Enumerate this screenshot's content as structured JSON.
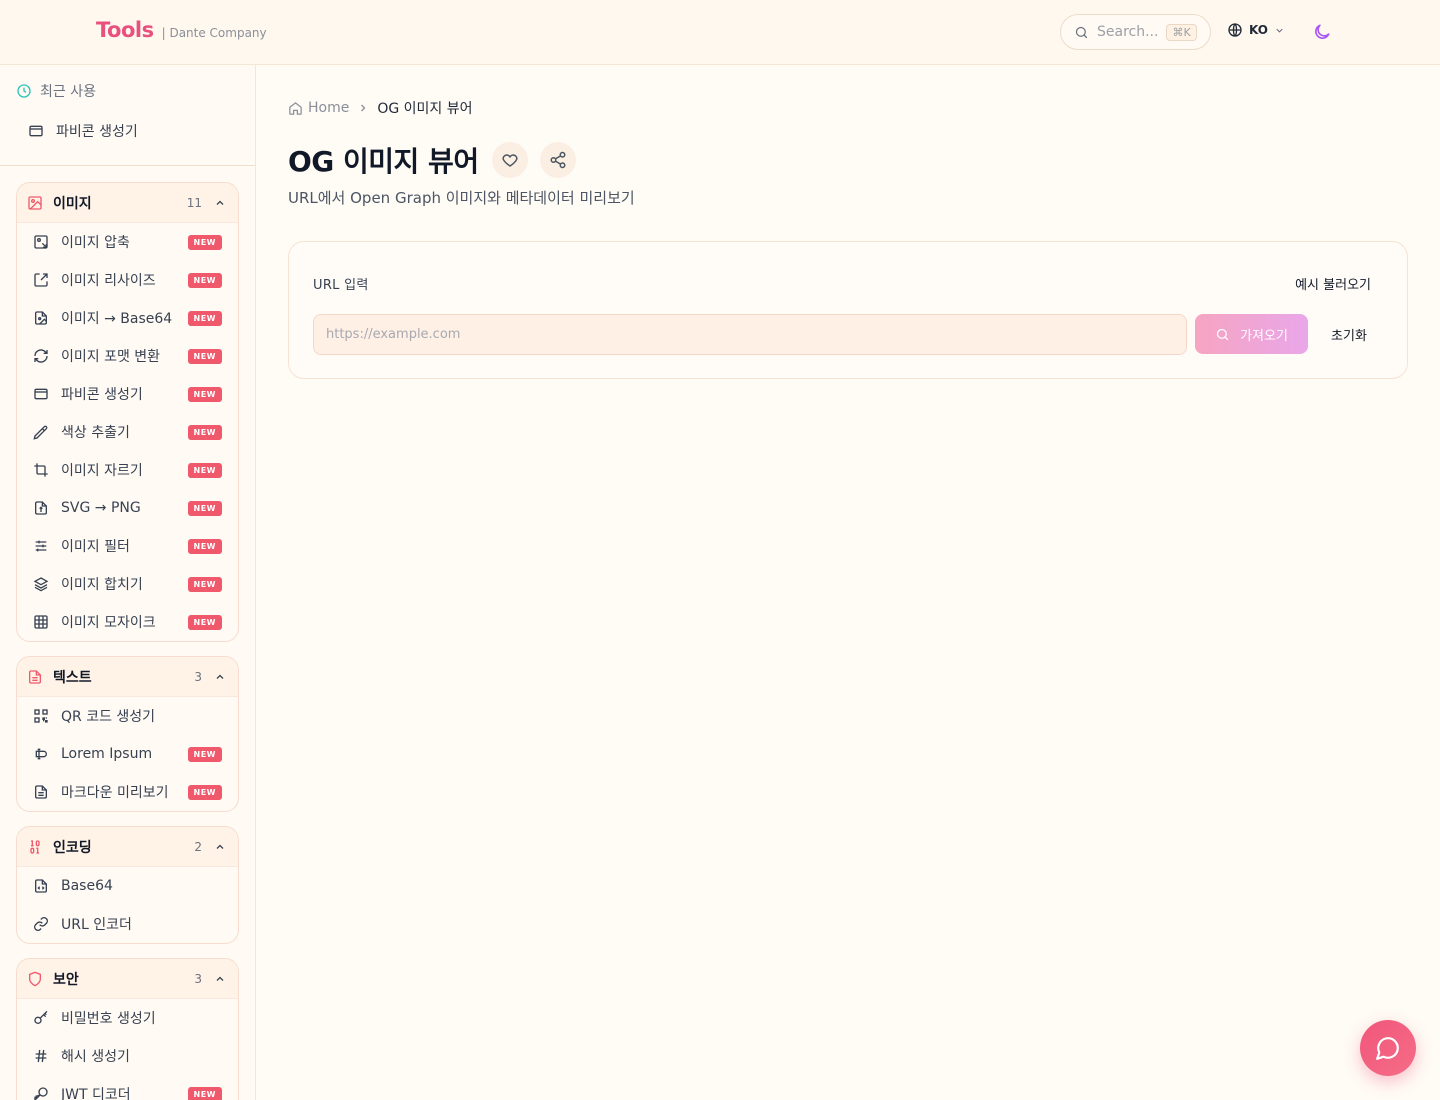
{
  "header": {
    "logo": "Tools",
    "company": "| Dante Company",
    "search_placeholder": "Search...",
    "search_shortcut": "⌘K",
    "language": "KO"
  },
  "sidebar": {
    "recent": {
      "title": "최근 사용",
      "items": [
        {
          "label": "파비콘 생성기",
          "icon": "browser-window-icon"
        }
      ]
    },
    "groups": [
      {
        "label": "이미지",
        "count": "11",
        "icon": "image-icon",
        "icon_color": "#f0596b",
        "items": [
          {
            "label": "이미지 압축",
            "icon": "image-compress-icon",
            "badge": "NEW"
          },
          {
            "label": "이미지 리사이즈",
            "icon": "resize-icon",
            "badge": "NEW"
          },
          {
            "label": "이미지 → Base64",
            "icon": "file-image-icon",
            "badge": "NEW"
          },
          {
            "label": "이미지 포맷 변환",
            "icon": "refresh-icon",
            "badge": "NEW"
          },
          {
            "label": "파비콘 생성기",
            "icon": "browser-window-icon",
            "badge": "NEW"
          },
          {
            "label": "색상 추출기",
            "icon": "pipette-icon",
            "badge": "NEW"
          },
          {
            "label": "이미지 자르기",
            "icon": "crop-icon",
            "badge": "NEW"
          },
          {
            "label": "SVG → PNG",
            "icon": "file-type-icon",
            "badge": "NEW"
          },
          {
            "label": "이미지 필터",
            "icon": "sliders-icon",
            "badge": "NEW"
          },
          {
            "label": "이미지 합치기",
            "icon": "layers-icon",
            "badge": "NEW"
          },
          {
            "label": "이미지 모자이크",
            "icon": "grid-icon",
            "badge": "NEW"
          }
        ]
      },
      {
        "label": "텍스트",
        "count": "3",
        "icon": "file-text-icon",
        "icon_color": "#f0596b",
        "items": [
          {
            "label": "QR 코드 생성기",
            "icon": "qr-code-icon",
            "badge": ""
          },
          {
            "label": "Lorem Ipsum",
            "icon": "text-cursor-icon",
            "badge": "NEW"
          },
          {
            "label": "마크다운 미리보기",
            "icon": "file-text-icon",
            "badge": "NEW"
          }
        ]
      },
      {
        "label": "인코딩",
        "count": "2",
        "icon": "binary-icon",
        "icon_color": "#f0596b",
        "items": [
          {
            "label": "Base64",
            "icon": "file-code-icon",
            "badge": ""
          },
          {
            "label": "URL 인코더",
            "icon": "link-icon",
            "badge": ""
          }
        ]
      },
      {
        "label": "보안",
        "count": "3",
        "icon": "shield-icon",
        "icon_color": "#f0596b",
        "items": [
          {
            "label": "비밀번호 생성기",
            "icon": "key-icon",
            "badge": ""
          },
          {
            "label": "해시 생성기",
            "icon": "hash-icon",
            "badge": ""
          },
          {
            "label": "JWT 디코더",
            "icon": "key-round-icon",
            "badge": "NEW"
          }
        ]
      }
    ]
  },
  "breadcrumb": {
    "home": "Home",
    "current": "OG 이미지 뷰어"
  },
  "page": {
    "title": "OG 이미지 뷰어",
    "subtitle": "URL에서 Open Graph 이미지와 메타데이터 미리보기"
  },
  "form": {
    "label": "URL 입력",
    "example_link": "예시 불러오기",
    "url_value": "",
    "url_placeholder": "https://example.com",
    "fetch_label": "가져오기",
    "reset_label": "초기화"
  },
  "colors": {
    "accent": "#e8507e",
    "badge": "#f0596b",
    "theme_icon": "#a855f7"
  }
}
